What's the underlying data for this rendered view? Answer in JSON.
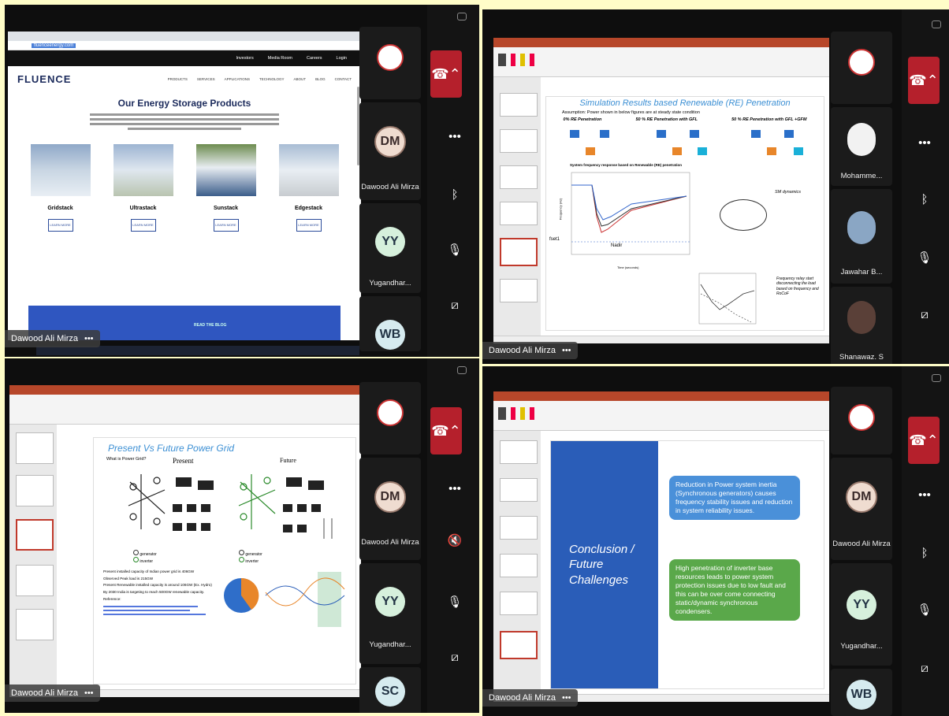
{
  "meeting": {
    "hangup_icon": "phone-hangup-icon",
    "more_label": "•••"
  },
  "q1": {
    "browser_url": "fluenceenergy.com",
    "site_nav_top": [
      "Investors",
      "Media Room",
      "Careers",
      "Login"
    ],
    "logo": "FLUENCE",
    "site_nav": [
      "PRODUCTS",
      "SERVICES",
      "APPLICATIONS",
      "TECHNOLOGY",
      "ABOUT",
      "BLOG",
      "CONTACT"
    ],
    "heading": "Our Energy Storage Products",
    "products": [
      {
        "name": "Gridstack",
        "button": "LEARN MORE"
      },
      {
        "name": "Ultrastack",
        "button": "LEARN MORE"
      },
      {
        "name": "Sunstack",
        "button": "LEARN MORE"
      },
      {
        "name": "Edgestack",
        "button": "LEARN MORE"
      }
    ],
    "blog_label": "READ THE BLOG",
    "presenter": "Dawood Ali Mirza",
    "participants": [
      {
        "initials": "DM",
        "name": "Dawood Ali Mirza"
      },
      {
        "initials": "YY",
        "name": "Yugandhar..."
      },
      {
        "initials": "WB",
        "name": ""
      }
    ]
  },
  "q2": {
    "slide_title": "Simulation Results based Renewable (RE) Penetration",
    "bullet": "Assumption: Power shown in below figures are at steady state condition",
    "cases": [
      "0% RE Penetration",
      "50 % RE Penetration with GFL",
      "50 % RE Penetration with GFL +GFM"
    ],
    "chart_title": "System frequency response based on Renewable (RE) penetration",
    "y_label": "Frequency (Hz)",
    "x_label": "Time (seconds)",
    "nadir_label": "Nadir",
    "fset_label": "fset1",
    "sm_label": "SM dynamics",
    "relay_note": "Frequency relay start disconnecting the load based on frequency and RoCoF",
    "presenter": "Dawood Ali Mirza",
    "participants": [
      {
        "initials": "",
        "name": "Mohamme..."
      },
      {
        "initials": "",
        "name": "Jawahar B..."
      },
      {
        "initials": "",
        "name": "Shanawaz. S"
      }
    ]
  },
  "q3": {
    "slide_title": "Present Vs Future Power Grid",
    "bullet_q": "What is Power Grid?",
    "present": "Present",
    "future": "Future",
    "legend_gen": "generator",
    "legend_inv": "inverter",
    "bullets": [
      "Present installed capacity of Indian power grid is 406GW",
      "Observed Peak load is 215GW",
      "Present Renewable installed capacity is around 106GW (Ex. Hydro)",
      "By 2030 India is targeting to reach 500GW renewable capacity."
    ],
    "reference": "Reference:",
    "presenter": "Dawood Ali Mirza",
    "participants": [
      {
        "initials": "DM",
        "name": "Dawood Ali Mirza"
      },
      {
        "initials": "YY",
        "name": "Yugandhar..."
      },
      {
        "initials": "SC",
        "name": ""
      }
    ]
  },
  "q4": {
    "slide_title": "Conclusion / Future Challenges",
    "point1": "Reduction in Power system inertia (Synchronous generators) causes frequency stability issues and reduction in system reliability issues.",
    "point2": "High penetration of inverter base resources leads to power system protection issues due to low fault and this can be over come connecting static/dynamic synchronous condensers.",
    "presenter": "Dawood Ali Mirza",
    "participants": [
      {
        "initials": "DM",
        "name": "Dawood Ali Mirza"
      },
      {
        "initials": "YY",
        "name": "Yugandhar..."
      },
      {
        "initials": "WB",
        "name": ""
      }
    ]
  },
  "colors": {
    "hangup": "#b5202c",
    "blue_slide": "#2a5db8",
    "conc_blue": "#4a90d9",
    "conc_green": "#5aa84a",
    "title_blue": "#3b8fd4"
  }
}
